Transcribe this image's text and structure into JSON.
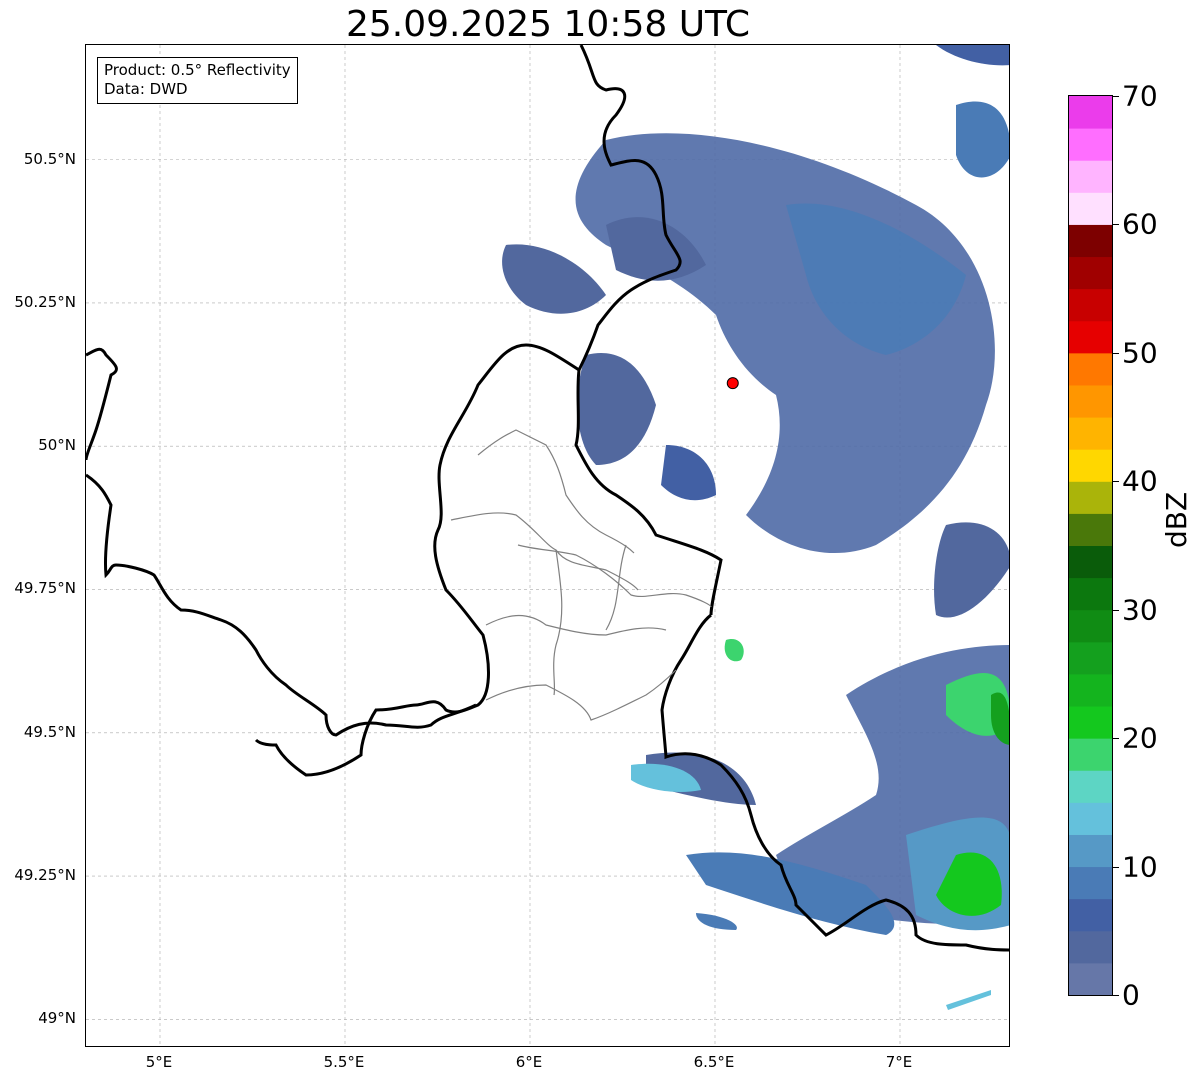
{
  "title": "25.09.2025 10:58 UTC",
  "info_box": {
    "line1": "Product: 0.5° Reflectivity",
    "line2": "Data: DWD"
  },
  "map": {
    "lon_range": [
      4.8,
      7.3
    ],
    "lat_range": [
      48.95,
      50.7
    ],
    "lat_ticks": [
      {
        "value": 50.5,
        "label": "50.5°N"
      },
      {
        "value": 50.25,
        "label": "50.25°N"
      },
      {
        "value": 50.0,
        "label": "50°N"
      },
      {
        "value": 49.75,
        "label": "49.75°N"
      },
      {
        "value": 49.5,
        "label": "49.5°N"
      },
      {
        "value": 49.25,
        "label": "49.25°N"
      },
      {
        "value": 49.0,
        "label": "49°N"
      }
    ],
    "lon_ticks": [
      {
        "value": 5.0,
        "label": "5°E"
      },
      {
        "value": 5.5,
        "label": "5.5°E"
      },
      {
        "value": 6.0,
        "label": "6°E"
      },
      {
        "value": 6.5,
        "label": "6.5°E"
      },
      {
        "value": 7.0,
        "label": "7°E"
      }
    ],
    "gridlines": true,
    "radar_site": {
      "lon": 6.548,
      "lat": 50.11,
      "color": "#ff0000"
    },
    "border_color": "#000000",
    "district_color": "#808080"
  },
  "colorbar": {
    "label": "dBZ",
    "min": 0,
    "max": 70,
    "step": 2.5,
    "ticks": [
      {
        "value": 0,
        "label": "0"
      },
      {
        "value": 10,
        "label": "10"
      },
      {
        "value": 20,
        "label": "20"
      },
      {
        "value": 30,
        "label": "30"
      },
      {
        "value": 40,
        "label": "40"
      },
      {
        "value": 50,
        "label": "50"
      },
      {
        "value": 60,
        "label": "60"
      },
      {
        "value": 70,
        "label": "70"
      }
    ],
    "colors": [
      "#6677a8",
      "#52689e",
      "#4260a4",
      "#4a7bb6",
      "#5699c6",
      "#64c1dc",
      "#5dd5c4",
      "#3cd46e",
      "#14c81e",
      "#14b41e",
      "#14a01e",
      "#108c14",
      "#0c780e",
      "#0a5c0a",
      "#4a780a",
      "#aab40a",
      "#ffd700",
      "#ffb400",
      "#ff9600",
      "#ff7800",
      "#e60000",
      "#c80000",
      "#a00000",
      "#7d0000",
      "#ffe0ff",
      "#ffb4ff",
      "#ff6eff",
      "#eb3ceb"
    ]
  }
}
